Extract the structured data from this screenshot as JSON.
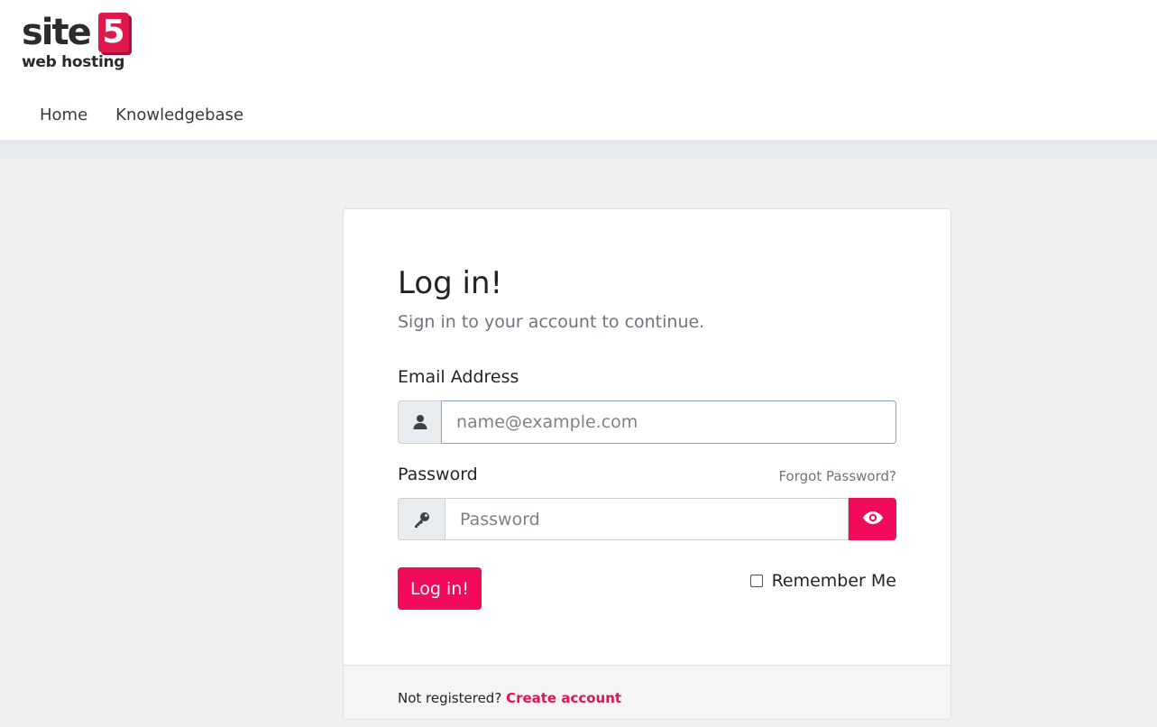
{
  "brand": {
    "logo_word": "site",
    "logo_number": "5",
    "logo_tagline": "web hosting",
    "accent_color": "#f20a5b"
  },
  "nav": {
    "items": [
      {
        "label": "Home"
      },
      {
        "label": "Knowledgebase"
      }
    ]
  },
  "login": {
    "title": "Log in!",
    "subtitle": "Sign in to your account to continue.",
    "email_label": "Email Address",
    "email_placeholder": "name@example.com",
    "email_value": "",
    "password_label": "Password",
    "password_placeholder": "Password",
    "password_value": "",
    "forgot_label": "Forgot Password?",
    "submit_label": "Log in!",
    "remember_label": "Remember Me",
    "remember_checked": false,
    "icons": {
      "email": "user-icon",
      "password": "key-icon",
      "toggle": "eye-icon"
    }
  },
  "footer": {
    "prompt": "Not registered?",
    "link_label": "Create account"
  }
}
